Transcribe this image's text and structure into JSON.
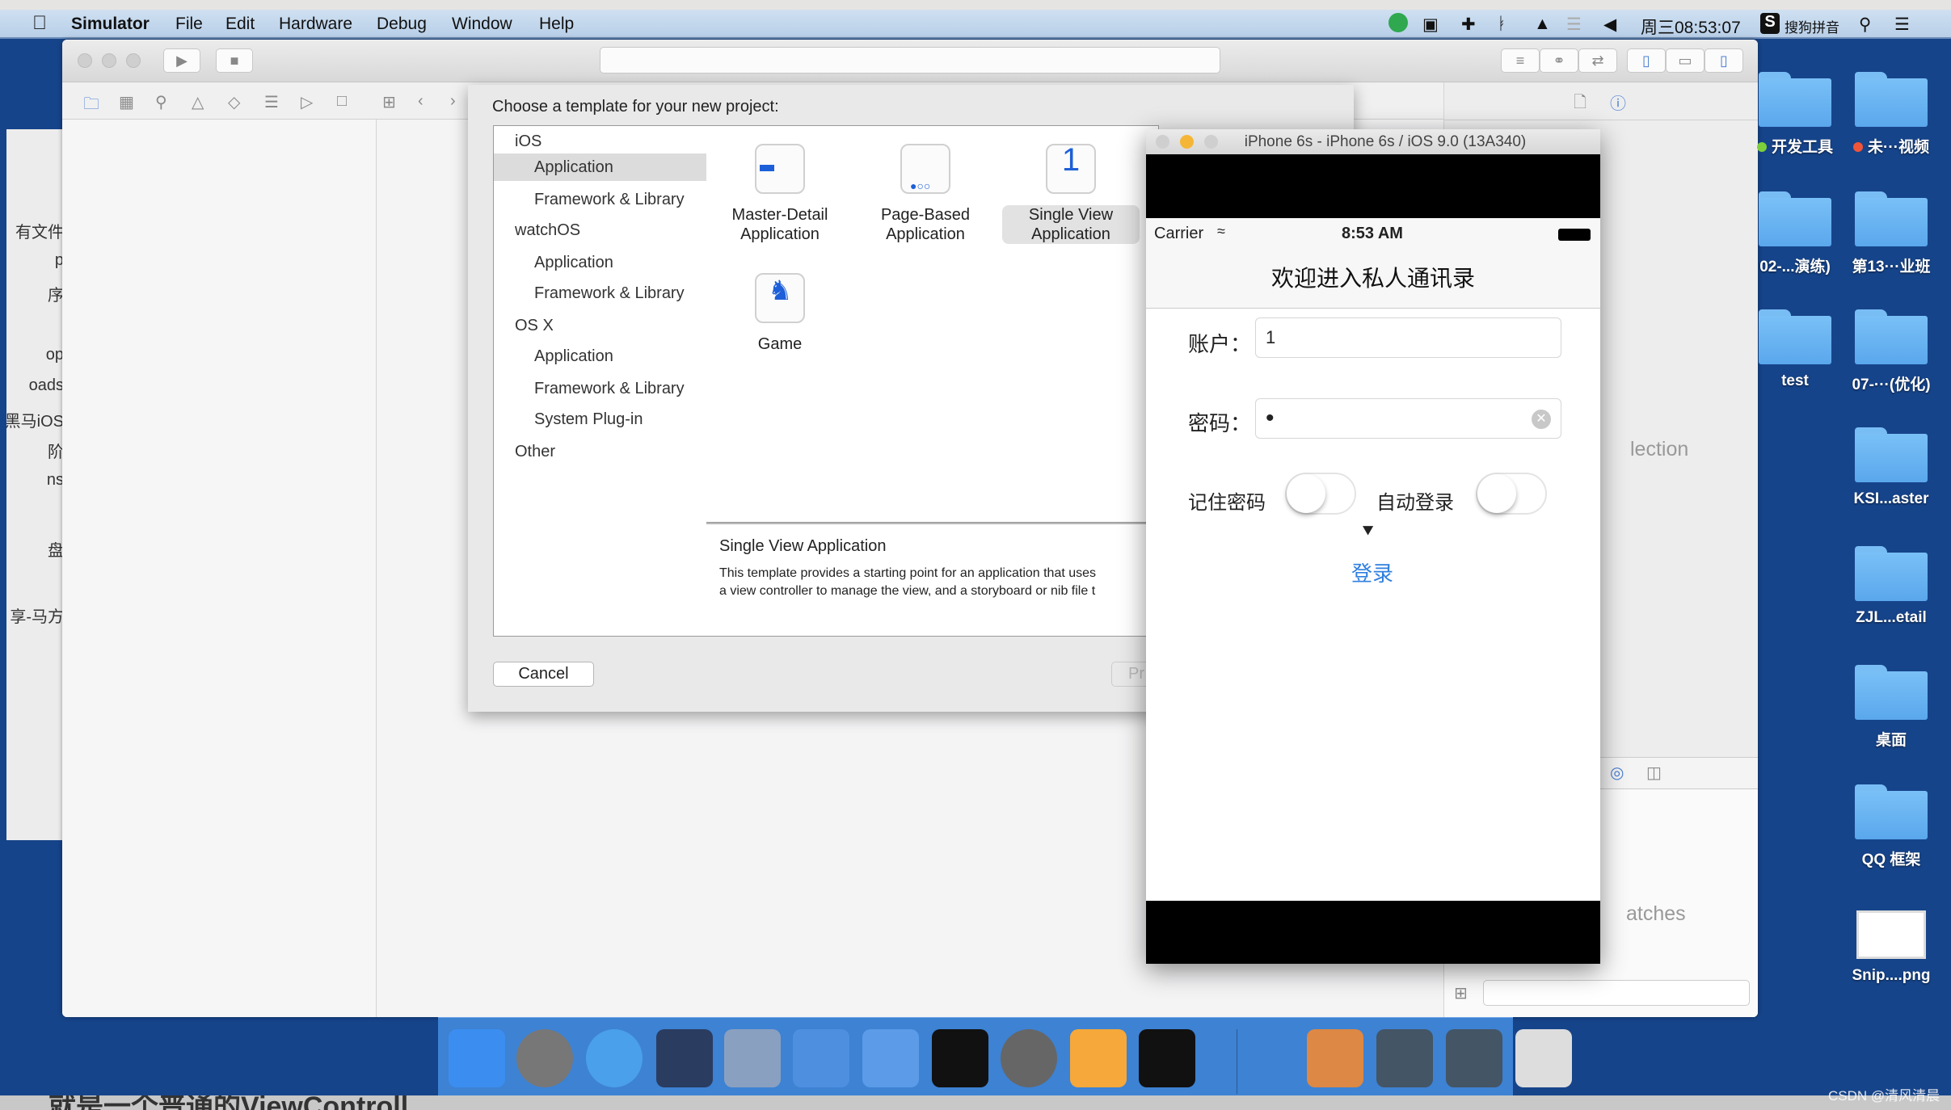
{
  "menubar": {
    "apple_icon": "apple-logo",
    "items": [
      "Simulator",
      "File",
      "Edit",
      "Hardware",
      "Debug",
      "Window",
      "Help"
    ],
    "clock": "周三08:53:07",
    "input_method": "搜狗拼音",
    "status_icons": [
      "play-circle-icon",
      "camera-icon",
      "airplane-icon",
      "bluetooth-icon",
      "lock-icon",
      "wifi-icon",
      "volume-icon"
    ]
  },
  "finder_sidebar": [
    "有文件",
    "p",
    "序",
    "op",
    "oads",
    "黑马iOS",
    "阶",
    "ns",
    "盘",
    "享-马方"
  ],
  "xcode": {
    "right_pane_text_1": "lection",
    "right_pane_text_2": "atches"
  },
  "template_sheet": {
    "title": "Choose a template for your new project:",
    "categories": [
      {
        "label": "iOS",
        "type": "header"
      },
      {
        "label": "Application",
        "type": "sub",
        "selected": true
      },
      {
        "label": "Framework & Library",
        "type": "sub"
      },
      {
        "label": "watchOS",
        "type": "header"
      },
      {
        "label": "Application",
        "type": "sub"
      },
      {
        "label": "Framework & Library",
        "type": "sub"
      },
      {
        "label": "OS X",
        "type": "header"
      },
      {
        "label": "Application",
        "type": "sub"
      },
      {
        "label": "Framework & Library",
        "type": "sub"
      },
      {
        "label": "System Plug-in",
        "type": "sub"
      },
      {
        "label": "Other",
        "type": "header"
      }
    ],
    "templates": [
      {
        "label": "Master-Detail Application",
        "icon": "master-detail-icon"
      },
      {
        "label": "Page-Based Application",
        "icon": "page-based-icon"
      },
      {
        "label": "Single View Application",
        "icon": "single-view-icon",
        "glyph": "1",
        "selected": true
      },
      {
        "label": "Game",
        "icon": "game-icon"
      }
    ],
    "description_title": "Single View Application",
    "description_line1": "This template provides a starting point for an application that uses",
    "description_line2": "a view controller to manage the view, and a storyboard or nib file t",
    "cancel_label": "Cancel",
    "next_label": "Pr"
  },
  "simulator": {
    "window_title": "iPhone 6s - iPhone 6s / iOS 9.0 (13A340)",
    "carrier": "Carrier",
    "time": "8:53 AM",
    "nav_title": "欢迎进入私人通讯录",
    "account_label": "账户：",
    "account_value": "1",
    "password_label": "密码：",
    "password_value": "•",
    "remember_label": "记住密码",
    "remember_on": false,
    "autologin_label": "自动登录",
    "autologin_on": false,
    "login_label": "登录",
    "accent": "#2f7fe0"
  },
  "desktop": [
    {
      "label": "开发工具",
      "tag": "#7ccf3a"
    },
    {
      "label": "未···视频",
      "tag": "#f0553a"
    },
    {
      "label": "02-...演练)"
    },
    {
      "label": "第13···业班"
    },
    {
      "label": "test"
    },
    {
      "label": "07-···(优化)"
    },
    {
      "label": "KSI...aster"
    },
    {
      "label": "ZJL...etail"
    },
    {
      "label": "桌面"
    },
    {
      "label": "QQ 框架"
    },
    {
      "label": "Snip....png",
      "type": "image"
    }
  ],
  "dock": [
    "finder",
    "launchpad",
    "safari",
    "mouse-app",
    "video-app",
    "xcode",
    "instruments",
    "terminal",
    "system-preferences",
    "sketch",
    "exec-terminal",
    "video-player",
    "network-app-1",
    "network-app-2",
    "trash"
  ],
  "caption": "就是一个普通的ViewControll",
  "watermark": "CSDN @清风清晨"
}
